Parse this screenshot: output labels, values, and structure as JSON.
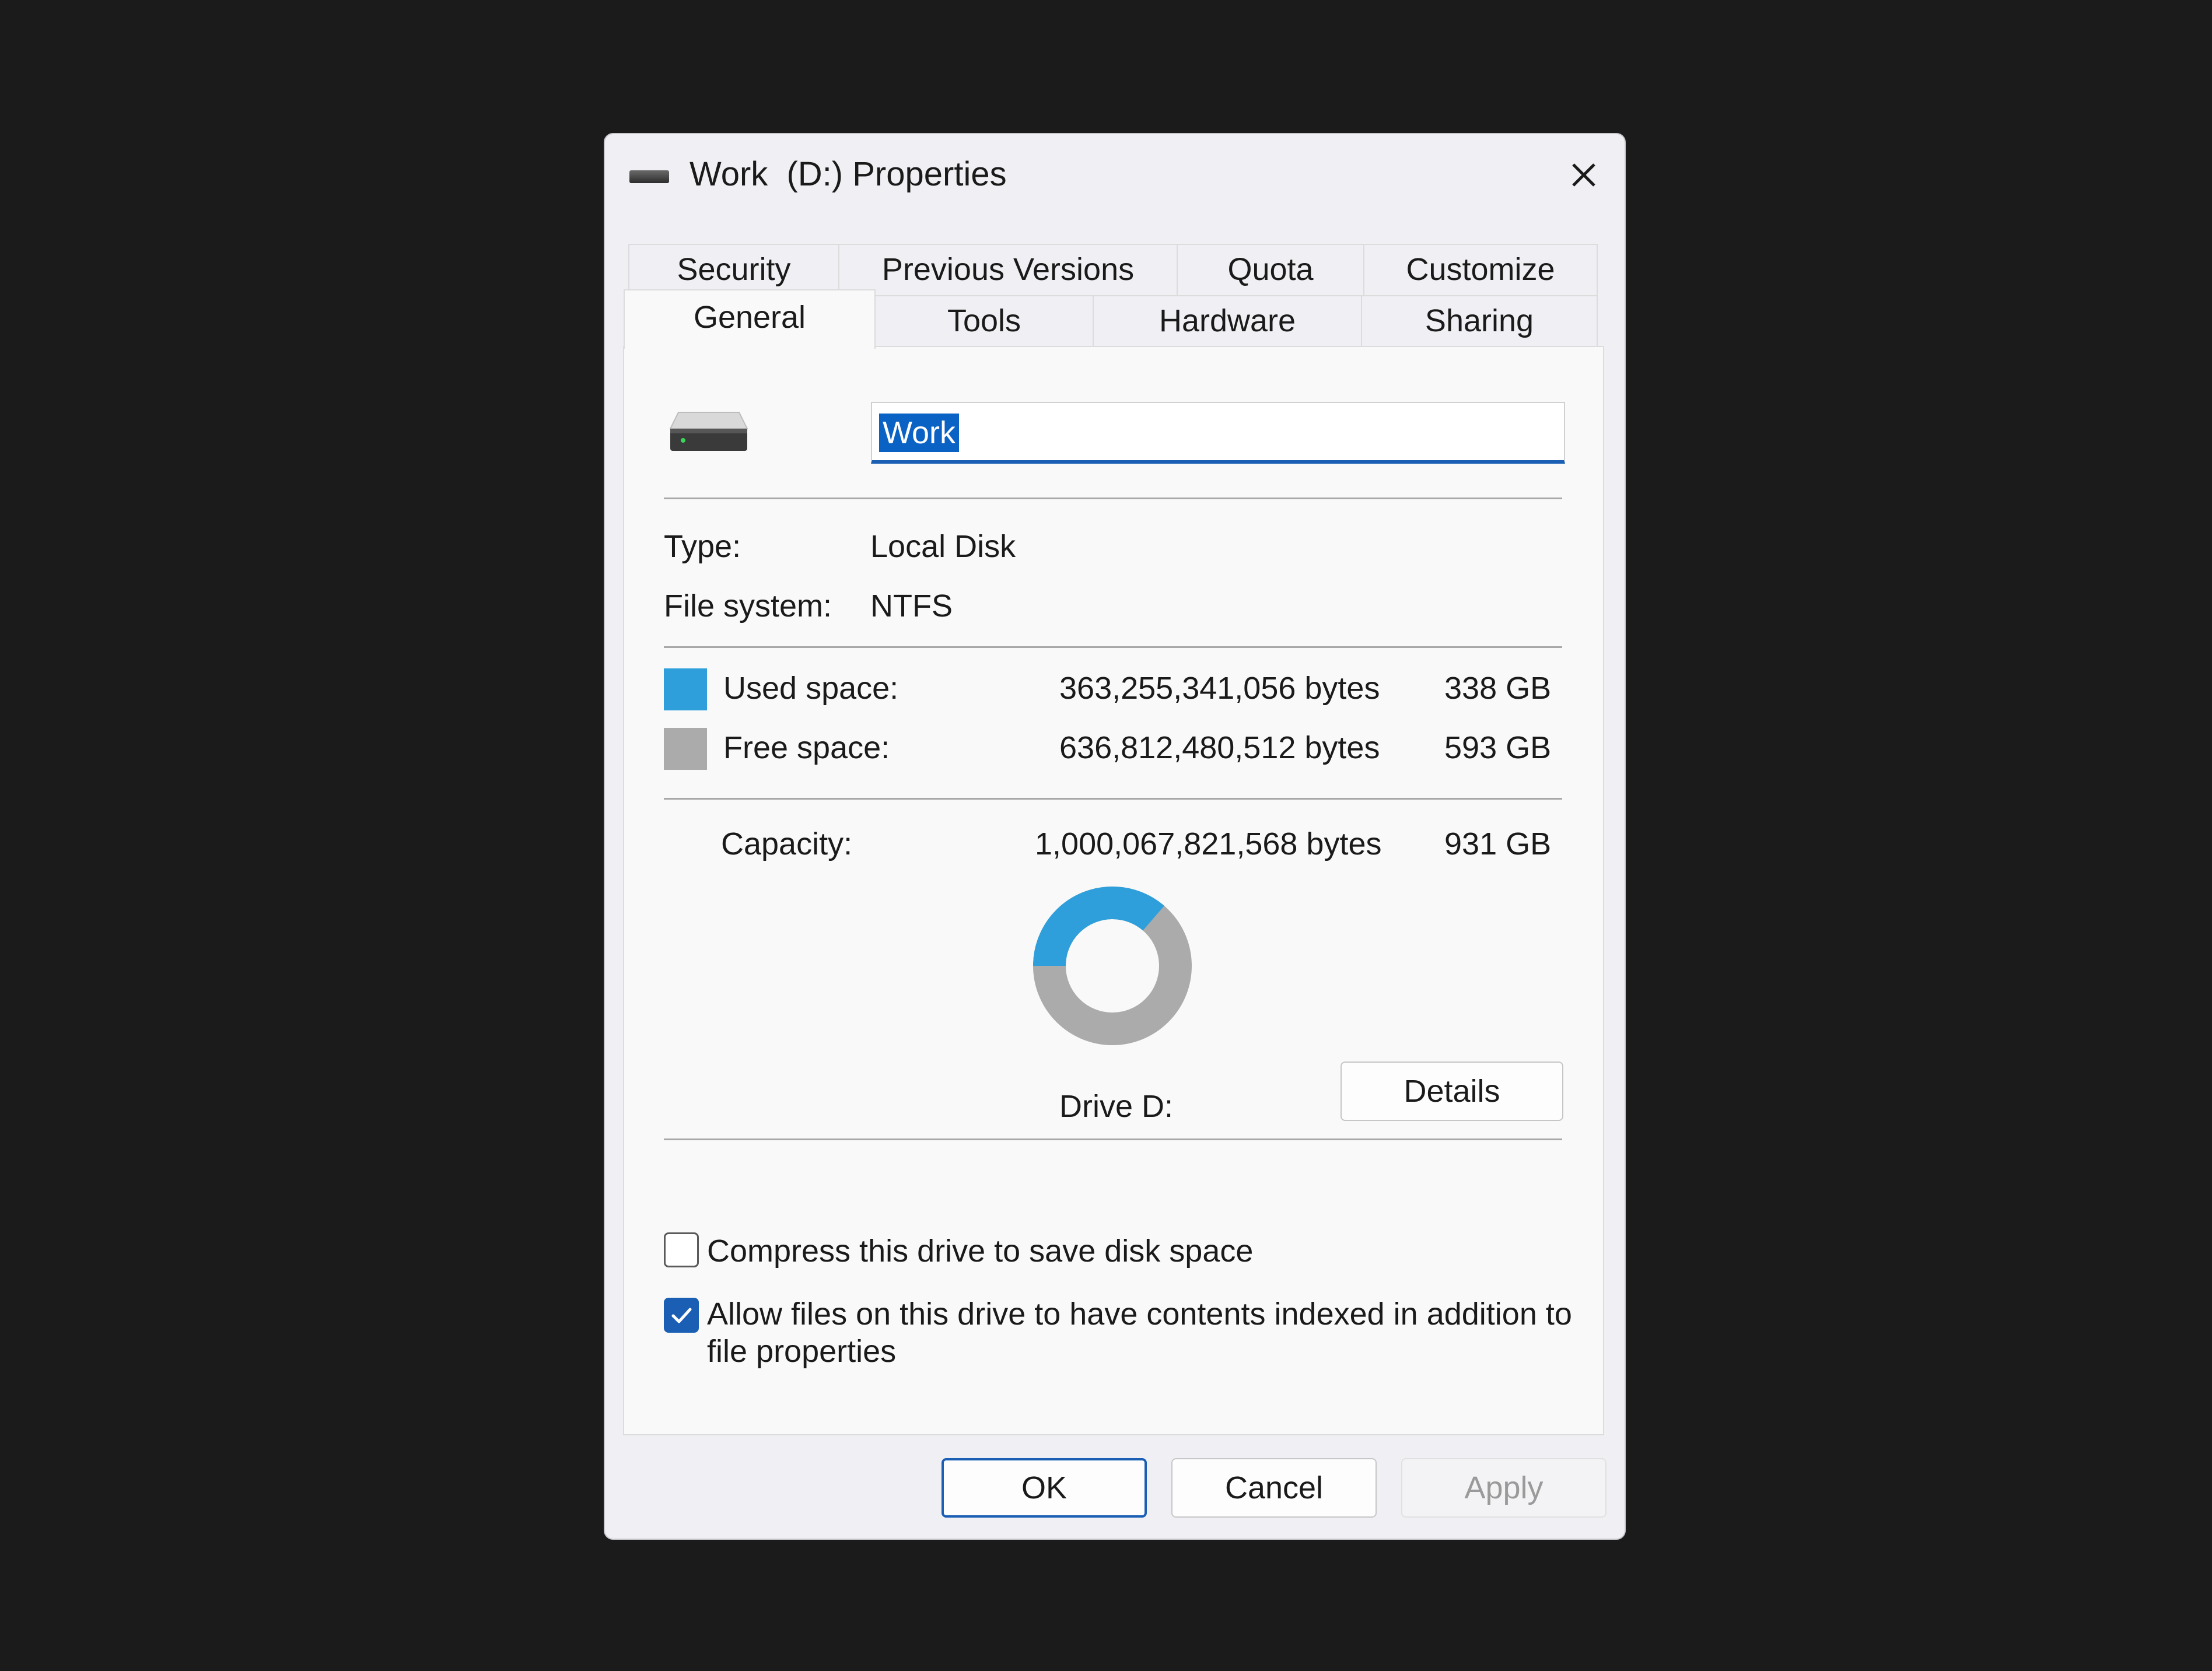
{
  "window": {
    "title": "Work  (D:) Properties",
    "icon": "drive-icon",
    "close_icon": "close-icon"
  },
  "tabs": {
    "row_back": [
      "Security",
      "Previous Versions",
      "Quota",
      "Customize"
    ],
    "row_front": [
      "General",
      "Tools",
      "Hardware",
      "Sharing"
    ],
    "active": "General"
  },
  "general": {
    "drive_name": "Work",
    "type_label": "Type:",
    "type_value": "Local Disk",
    "fs_label": "File system:",
    "fs_value": "NTFS",
    "used_label": "Used space:",
    "used_bytes": "363,255,341,056 bytes",
    "used_gb": "338 GB",
    "free_label": "Free space:",
    "free_bytes": "636,812,480,512 bytes",
    "free_gb": "593 GB",
    "capacity_label": "Capacity:",
    "capacity_bytes": "1,000,067,821,568 bytes",
    "capacity_gb": "931 GB",
    "drive_caption": "Drive D:",
    "details_button": "Details",
    "used_fraction": 0.3632,
    "colors": {
      "used": "#2e9fdb",
      "free": "#ababab",
      "accent": "#1a5fb4"
    }
  },
  "options": {
    "compress_label": "Compress this drive to save disk space",
    "compress_checked": false,
    "index_label_line1": "Allow files on this drive to have contents indexed in addition to",
    "index_label_line2": "file properties",
    "index_checked": true
  },
  "buttons": {
    "ok": "OK",
    "cancel": "Cancel",
    "apply": "Apply"
  }
}
